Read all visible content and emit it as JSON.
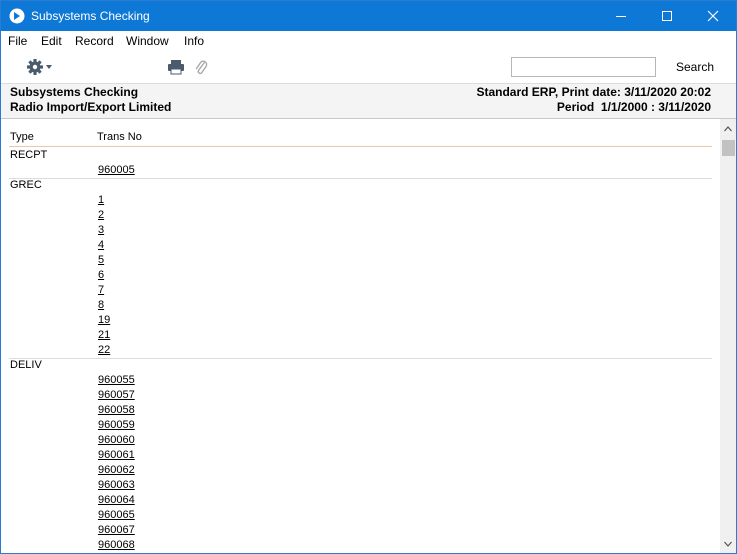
{
  "window": {
    "title": "Subsystems Checking"
  },
  "menu": [
    "File",
    "Edit",
    "Record",
    "Window",
    "Info"
  ],
  "toolbar": {
    "search_value": "",
    "search_label": "Search"
  },
  "report": {
    "title": "Subsystems Checking",
    "company": "Radio Import/Export Limited",
    "print_info": "Standard ERP, Print date: 3/11/2020 20:02",
    "period": "Period  1/1/2000 : 3/11/2020"
  },
  "columns": {
    "type": "Type",
    "trans_no": "Trans No"
  },
  "groups": [
    {
      "type": "RECPT",
      "trans": [
        "960005"
      ]
    },
    {
      "type": "GREC",
      "trans": [
        "1",
        "2",
        "3",
        "4",
        "5",
        "6",
        "7",
        "8",
        "19",
        "21",
        "22"
      ]
    },
    {
      "type": "DELIV",
      "trans": [
        "960055",
        "960057",
        "960058",
        "960059",
        "960060",
        "960061",
        "960062",
        "960063",
        "960064",
        "960065",
        "960067",
        "960068"
      ]
    }
  ]
}
